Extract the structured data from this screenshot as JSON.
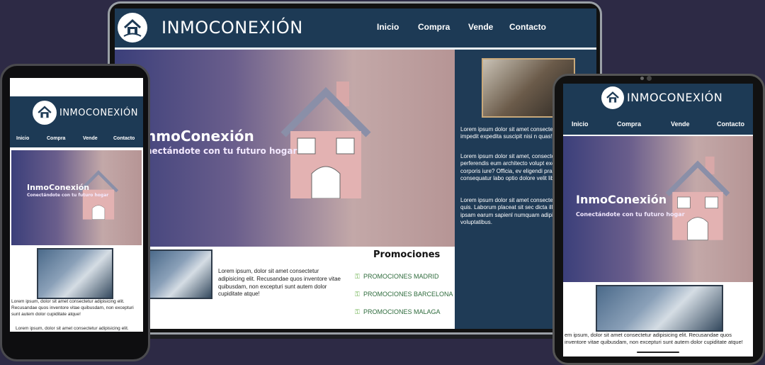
{
  "brand": "INMOCONEXIÓN",
  "nav": [
    "Inicio",
    "Compra",
    "Vende",
    "Contacto"
  ],
  "hero": {
    "laptop_title": "nmoConexión",
    "laptop_subtitle": "nectándote con tu futuro hogar",
    "title": "InmoConexión",
    "subtitle": "Conectándote con tu futuro hogar"
  },
  "sidebar_paragraphs": [
    "Lorem ipsum dolor sit amet consectetu Optio id, impedit expedita suscipit nisi n quas!",
    "Lorem ipsum dolor sit amet, consectetu Quo, perferendis eum architecto volupt exercitationem corporis iure? Officia, ev eligendi praesentium consequatur labo optio dolore velit libero.",
    "Lorem ipsum dolor sit amet consectetu Possimus, quis. Laborum placeat sit sec dicta illo ad saepe ipsam earum sapienl numquam adipisci, rem voluptatibus."
  ],
  "main_paragraph": "Lorem ipsum, dolor sit amet consectetur adipisicing elit. Recusandae quos inventore vitae quibusdam, non excepturi sunt autem dolor cupiditate atque!",
  "promotions": {
    "title": "Promociones",
    "items": [
      "PROMOCIONES MADRID",
      "PROMOCIONES BARCELONA",
      "PROMOCIONES MALAGA"
    ]
  },
  "phone_paragraph": "Lorem ipsum, dolor sit amet consectetur adipisicing elit. Recusandae quos inventore vitae quibusdam, non excepturi sunt autem dolor cupiditate atque!",
  "phone_paragraph_2": "Lorem ipsum, dolor sit amet consectetur adipisicing elit.",
  "tablet_paragraph": "em ipsum, dolor sit amet consectetur adipisicing elit. Recusandae quos inventore vitae quibusdam, non excepturi sunt autem dolor cupiditate atque!",
  "colors": {
    "nav": "#1d3a55",
    "background": "#2d2a45",
    "sidebar": "#20364f",
    "promo_link": "#2e6b3c"
  }
}
